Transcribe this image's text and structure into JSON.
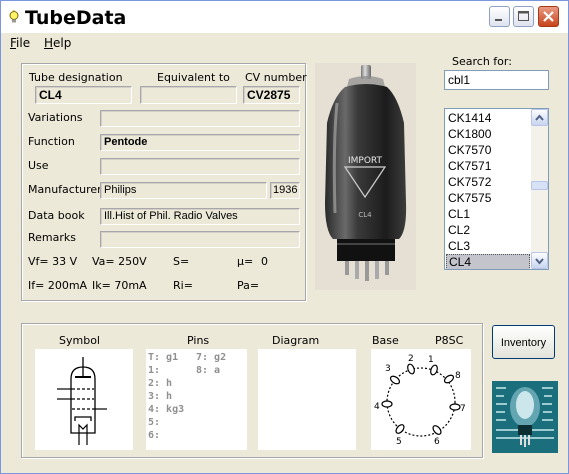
{
  "window": {
    "title": "TubeData"
  },
  "menu": {
    "file": "ile",
    "file_key": "F",
    "help": "elp",
    "help_key": "H"
  },
  "labels": {
    "tube_designation": "Tube designation",
    "equivalent_to": "Equivalent to",
    "cv_number": "CV number",
    "variations": "Variations",
    "function": "Function",
    "use": "Use",
    "manufacturer": "Manufacturer",
    "data_book": "Data book",
    "remarks": "Remarks"
  },
  "fields": {
    "tube_designation": "CL4",
    "equivalent_to": "",
    "cv_number": "CV2875",
    "variations": "",
    "function": "Pentode",
    "use": "",
    "manufacturer": "Philips",
    "year": "1936",
    "data_book": "Ill.Hist of Phil. Radio Valves",
    "remarks": ""
  },
  "params": {
    "vf": "Vf= 33 V",
    "va": "Va= 250V",
    "s": "S=",
    "mu": "µ=",
    "mu_val": "0",
    "if": "If= 200mA",
    "ik": "Ik= 70mA",
    "ri": "Ri=",
    "pa": "Pa="
  },
  "photo_text": {
    "brand": "IMPORT",
    "type": "CL4"
  },
  "search": {
    "label": "Search for:",
    "value": "cbl1"
  },
  "tube_list": {
    "items": [
      "CK1414",
      "CK1800",
      "CK7570",
      "CK7571",
      "CK7572",
      "CK7575",
      "CL1",
      "CL2",
      "CL3",
      "CL4"
    ],
    "selected": "CL4"
  },
  "bottom": {
    "symbol": "Symbol",
    "pins": "Pins",
    "diagram": "Diagram",
    "base": "Base",
    "base_type": "P8SC"
  },
  "pins_list": {
    "left": [
      "T: g1",
      "1:",
      "2: h",
      "3: h",
      "4: kg3",
      "5:",
      "6:"
    ],
    "right": [
      "7: g2",
      "8: a"
    ]
  },
  "base_pins": [
    "1",
    "2",
    "3",
    "4",
    "5",
    "6",
    "7",
    "8"
  ],
  "buttons": {
    "inventory": "Inventory"
  },
  "colors": {
    "title_bar": "#ffffff",
    "window_bg": "#ece9d8",
    "close_button": "#c8441b",
    "selection": "#c4c4cc"
  }
}
